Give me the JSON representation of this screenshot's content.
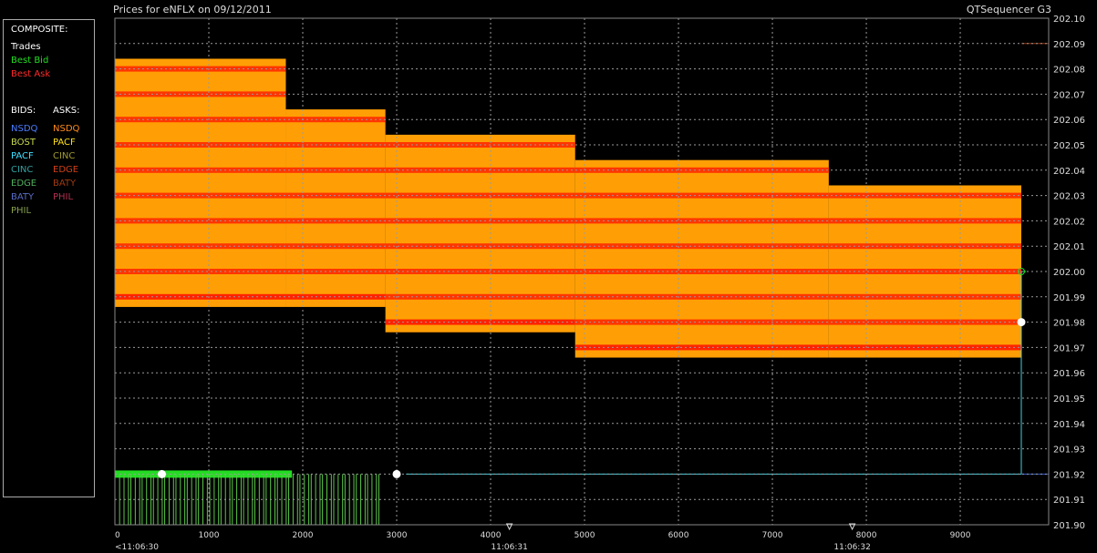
{
  "header": {
    "title": "Prices for  eNFLX  on  09/12/2011",
    "app_name": "QTSequencer G3"
  },
  "legend": {
    "composite_heading": "COMPOSITE:",
    "composite_items": [
      {
        "label": "Trades",
        "color": "#ffffff"
      },
      {
        "label": "Best Bid",
        "color": "#22dd22"
      },
      {
        "label": "Best Ask",
        "color": "#ff2a2a"
      }
    ],
    "bids_heading": "BIDS:",
    "asks_heading": "ASKS:",
    "bids": [
      {
        "label": "NSDQ",
        "color": "#4a7dff"
      },
      {
        "label": "BOST",
        "color": "#c8d850"
      },
      {
        "label": "PACF",
        "color": "#40e0ff"
      },
      {
        "label": "CINC",
        "color": "#30a0a0"
      },
      {
        "label": "EDGE",
        "color": "#52b060"
      },
      {
        "label": "BATY",
        "color": "#5a6cc8"
      },
      {
        "label": "PHIL",
        "color": "#88a050"
      }
    ],
    "asks": [
      {
        "label": "NSDQ",
        "color": "#ff8a1a"
      },
      {
        "label": "PACF",
        "color": "#ffe020"
      },
      {
        "label": "CINC",
        "color": "#a09a30"
      },
      {
        "label": "EDGE",
        "color": "#d0401a"
      },
      {
        "label": "BATY",
        "color": "#a03a10"
      },
      {
        "label": "PHIL",
        "color": "#b03050"
      }
    ]
  },
  "chart_data": {
    "type": "area",
    "title": "Prices for  eNFLX  on  09/12/2011",
    "xlim": [
      0,
      9650
    ],
    "ylim": [
      201.9,
      202.1
    ],
    "x_ticks": [
      0,
      1000,
      2000,
      3000,
      4000,
      5000,
      6000,
      7000,
      8000,
      9000
    ],
    "time_markers": [
      {
        "x": 0,
        "label": "<11:06:30"
      },
      {
        "x": 4200,
        "label": "11:06:31"
      },
      {
        "x": 7850,
        "label": "11:06:32"
      }
    ],
    "y_ticks": [
      "202.10",
      "202.09",
      "202.08",
      "202.07",
      "202.06",
      "202.05",
      "202.04",
      "202.03",
      "202.02",
      "202.01",
      "202.00",
      "201.99",
      "201.98",
      "201.97",
      "201.96",
      "201.95",
      "201.94",
      "201.93",
      "201.92",
      "201.91",
      "201.90"
    ],
    "grid": true,
    "ask_depth_segments": [
      {
        "x_start": 0,
        "x_end": 1820,
        "low": 201.99,
        "high": 202.08
      },
      {
        "x_start": 1820,
        "x_end": 2880,
        "low": 201.99,
        "high": 202.06
      },
      {
        "x_start": 2880,
        "x_end": 4900,
        "low": 201.98,
        "high": 202.05
      },
      {
        "x_start": 4900,
        "x_end": 7600,
        "low": 201.97,
        "high": 202.04
      },
      {
        "x_start": 7600,
        "x_end": 9650,
        "low": 201.97,
        "high": 202.03
      }
    ],
    "best_bid": [
      {
        "x": 0,
        "y": 201.92
      },
      {
        "x": 3050,
        "y": 201.92
      }
    ],
    "best_ask": [
      201.99,
      201.98,
      201.97
    ],
    "trades": [
      {
        "x": 500,
        "y": 201.92
      },
      {
        "x": 3000,
        "y": 201.92
      },
      {
        "x": 9650,
        "y": 201.98
      }
    ],
    "bid_quote_line": [
      {
        "x": 3100,
        "y": 201.92
      },
      {
        "x": 9650,
        "y": 201.92
      },
      {
        "x": 9650,
        "y": 202.0
      },
      {
        "x": 9700,
        "y": 202.0
      }
    ],
    "colors": {
      "ask_fill": "#ff9f05",
      "ask_stripe": "#ff2200",
      "bid_fill": "#22dd22",
      "bid_line": "#40d0e0",
      "grid": "#9a9a9a"
    }
  }
}
